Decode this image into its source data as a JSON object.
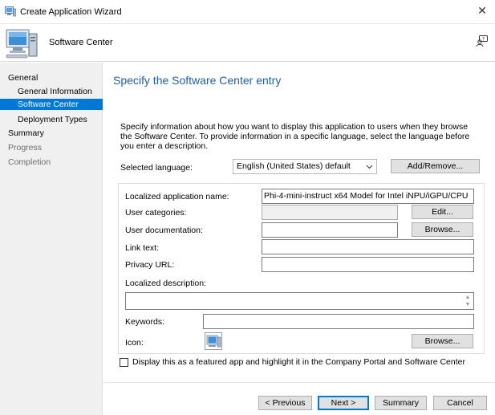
{
  "window": {
    "title": "Create Application Wizard",
    "close_glyph": "✕"
  },
  "header": {
    "subtitle": "Software Center"
  },
  "nav": {
    "items": [
      {
        "label": "General",
        "state": "normal"
      },
      {
        "label": "General Information",
        "state": "normal"
      },
      {
        "label": "Software Center",
        "state": "active"
      },
      {
        "label": "Deployment Types",
        "state": "normal"
      },
      {
        "label": "Summary",
        "state": "normal"
      },
      {
        "label": "Progress",
        "state": "disabled"
      },
      {
        "label": "Completion",
        "state": "disabled"
      }
    ]
  },
  "page": {
    "title": "Specify the Software Center entry",
    "intro": "Specify information about how you want to display this application to users when they browse the Software Center. To provide information in a specific language, select the language before you enter a description."
  },
  "language": {
    "label": "Selected language:",
    "value": "English (United States) default",
    "add_remove_label": "Add/Remove..."
  },
  "form": {
    "app_name_label": "Localized application name:",
    "app_name_value": "Phi-4-mini-instruct x64 Model for Intel iNPU/iGPU/CPU",
    "user_categories_label": "User categories:",
    "user_categories_value": "",
    "edit_label": "Edit...",
    "user_doc_label": "User documentation:",
    "user_doc_value": "",
    "browse_label": "Browse...",
    "link_text_label": "Link text:",
    "link_text_value": "",
    "privacy_label": "Privacy URL:",
    "privacy_value": "",
    "description_label": "Localized description:",
    "description_value": "",
    "keywords_label": "Keywords:",
    "keywords_value": "",
    "icon_label": "Icon:",
    "icon_browse_label": "Browse..."
  },
  "featured": {
    "checked": false,
    "label": "Display this as a featured app and highlight it in the Company Portal and Software Center"
  },
  "footer": {
    "previous_label": "< Previous",
    "next_label": "Next >",
    "summary_label": "Summary",
    "cancel_label": "Cancel"
  },
  "colors": {
    "accent": "#0078d7",
    "title_blue": "#1f5fa6",
    "sidebar_bg": "#f0f0f0"
  },
  "icons": {
    "app": "computer-wizard-icon",
    "help": "help-user-icon",
    "close": "close-icon",
    "dropdown": "chevron-down-icon"
  }
}
